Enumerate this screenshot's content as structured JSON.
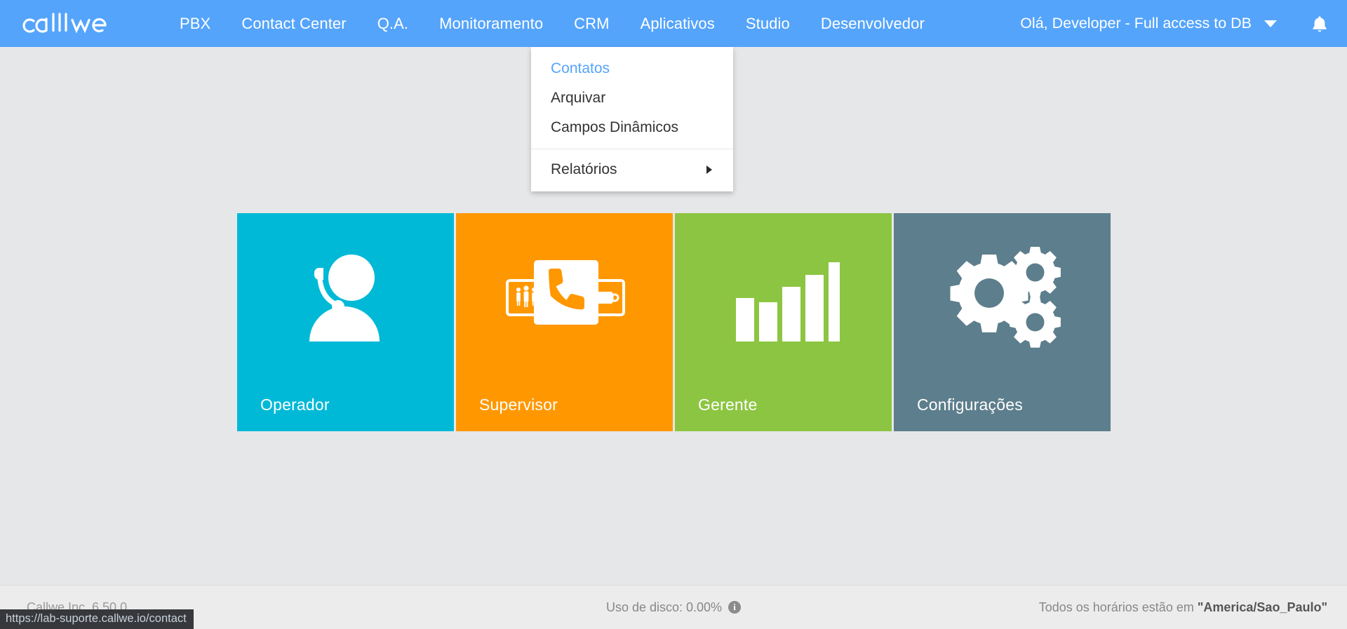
{
  "brand": {
    "name": "callwe",
    "logo_icon": "callwe-wordmark-logo"
  },
  "topnav": {
    "background": "#55a4fb",
    "items": [
      {
        "label": "PBX",
        "name": "pbx"
      },
      {
        "label": "Contact Center",
        "name": "contact-center"
      },
      {
        "label": "Q.A.",
        "name": "qa"
      },
      {
        "label": "Monitoramento",
        "name": "monitoramento"
      },
      {
        "label": "CRM",
        "name": "crm"
      },
      {
        "label": "Aplicativos",
        "name": "aplicativos"
      },
      {
        "label": "Studio",
        "name": "studio"
      },
      {
        "label": "Desenvolvedor",
        "name": "desenvolvedor"
      }
    ],
    "user_label": "Olá, Developer - Full access to DB",
    "caret_icon": "chevron-down-icon",
    "bell_icon": "bell-icon"
  },
  "crm_dropdown": {
    "open_for": "CRM",
    "highlight_color": "#55a4fb",
    "items": [
      {
        "label": "Contatos",
        "name": "contatos",
        "highlighted": true,
        "submenu": false
      },
      {
        "label": "Arquivar",
        "name": "arquivar",
        "highlighted": false,
        "submenu": false
      },
      {
        "label": "Campos Dinâmicos",
        "name": "campos-dinamicos",
        "highlighted": false,
        "submenu": false
      }
    ],
    "items_after_separator": [
      {
        "label": "Relatórios",
        "name": "relatorios",
        "highlighted": false,
        "submenu": true,
        "submenu_icon": "chevron-right-icon"
      }
    ]
  },
  "tiles": [
    {
      "label": "Operador",
      "name": "operador",
      "color": "#00b9d7",
      "icon": "headset-agent-icon"
    },
    {
      "label": "Supervisor",
      "name": "supervisor",
      "color": "#ff9800",
      "icon": "phone-queue-icon"
    },
    {
      "label": "Gerente",
      "name": "gerente",
      "color": "#8cc542",
      "icon": "bar-chart-icon"
    },
    {
      "label": "Configurações",
      "name": "configuracoes",
      "color": "#5d7e8c",
      "icon": "gears-icon"
    }
  ],
  "footer": {
    "left": "Callwe Inc. 6.50.0",
    "disk_usage": "Uso de disco: 0.00%",
    "disk_info_icon": "info-icon",
    "timezone_prefix": "Todos os horários estão em ",
    "timezone_value": "\"America/Sao_Paulo\""
  },
  "status_bar": {
    "url": "https://lab-suporte.callwe.io/contact"
  }
}
